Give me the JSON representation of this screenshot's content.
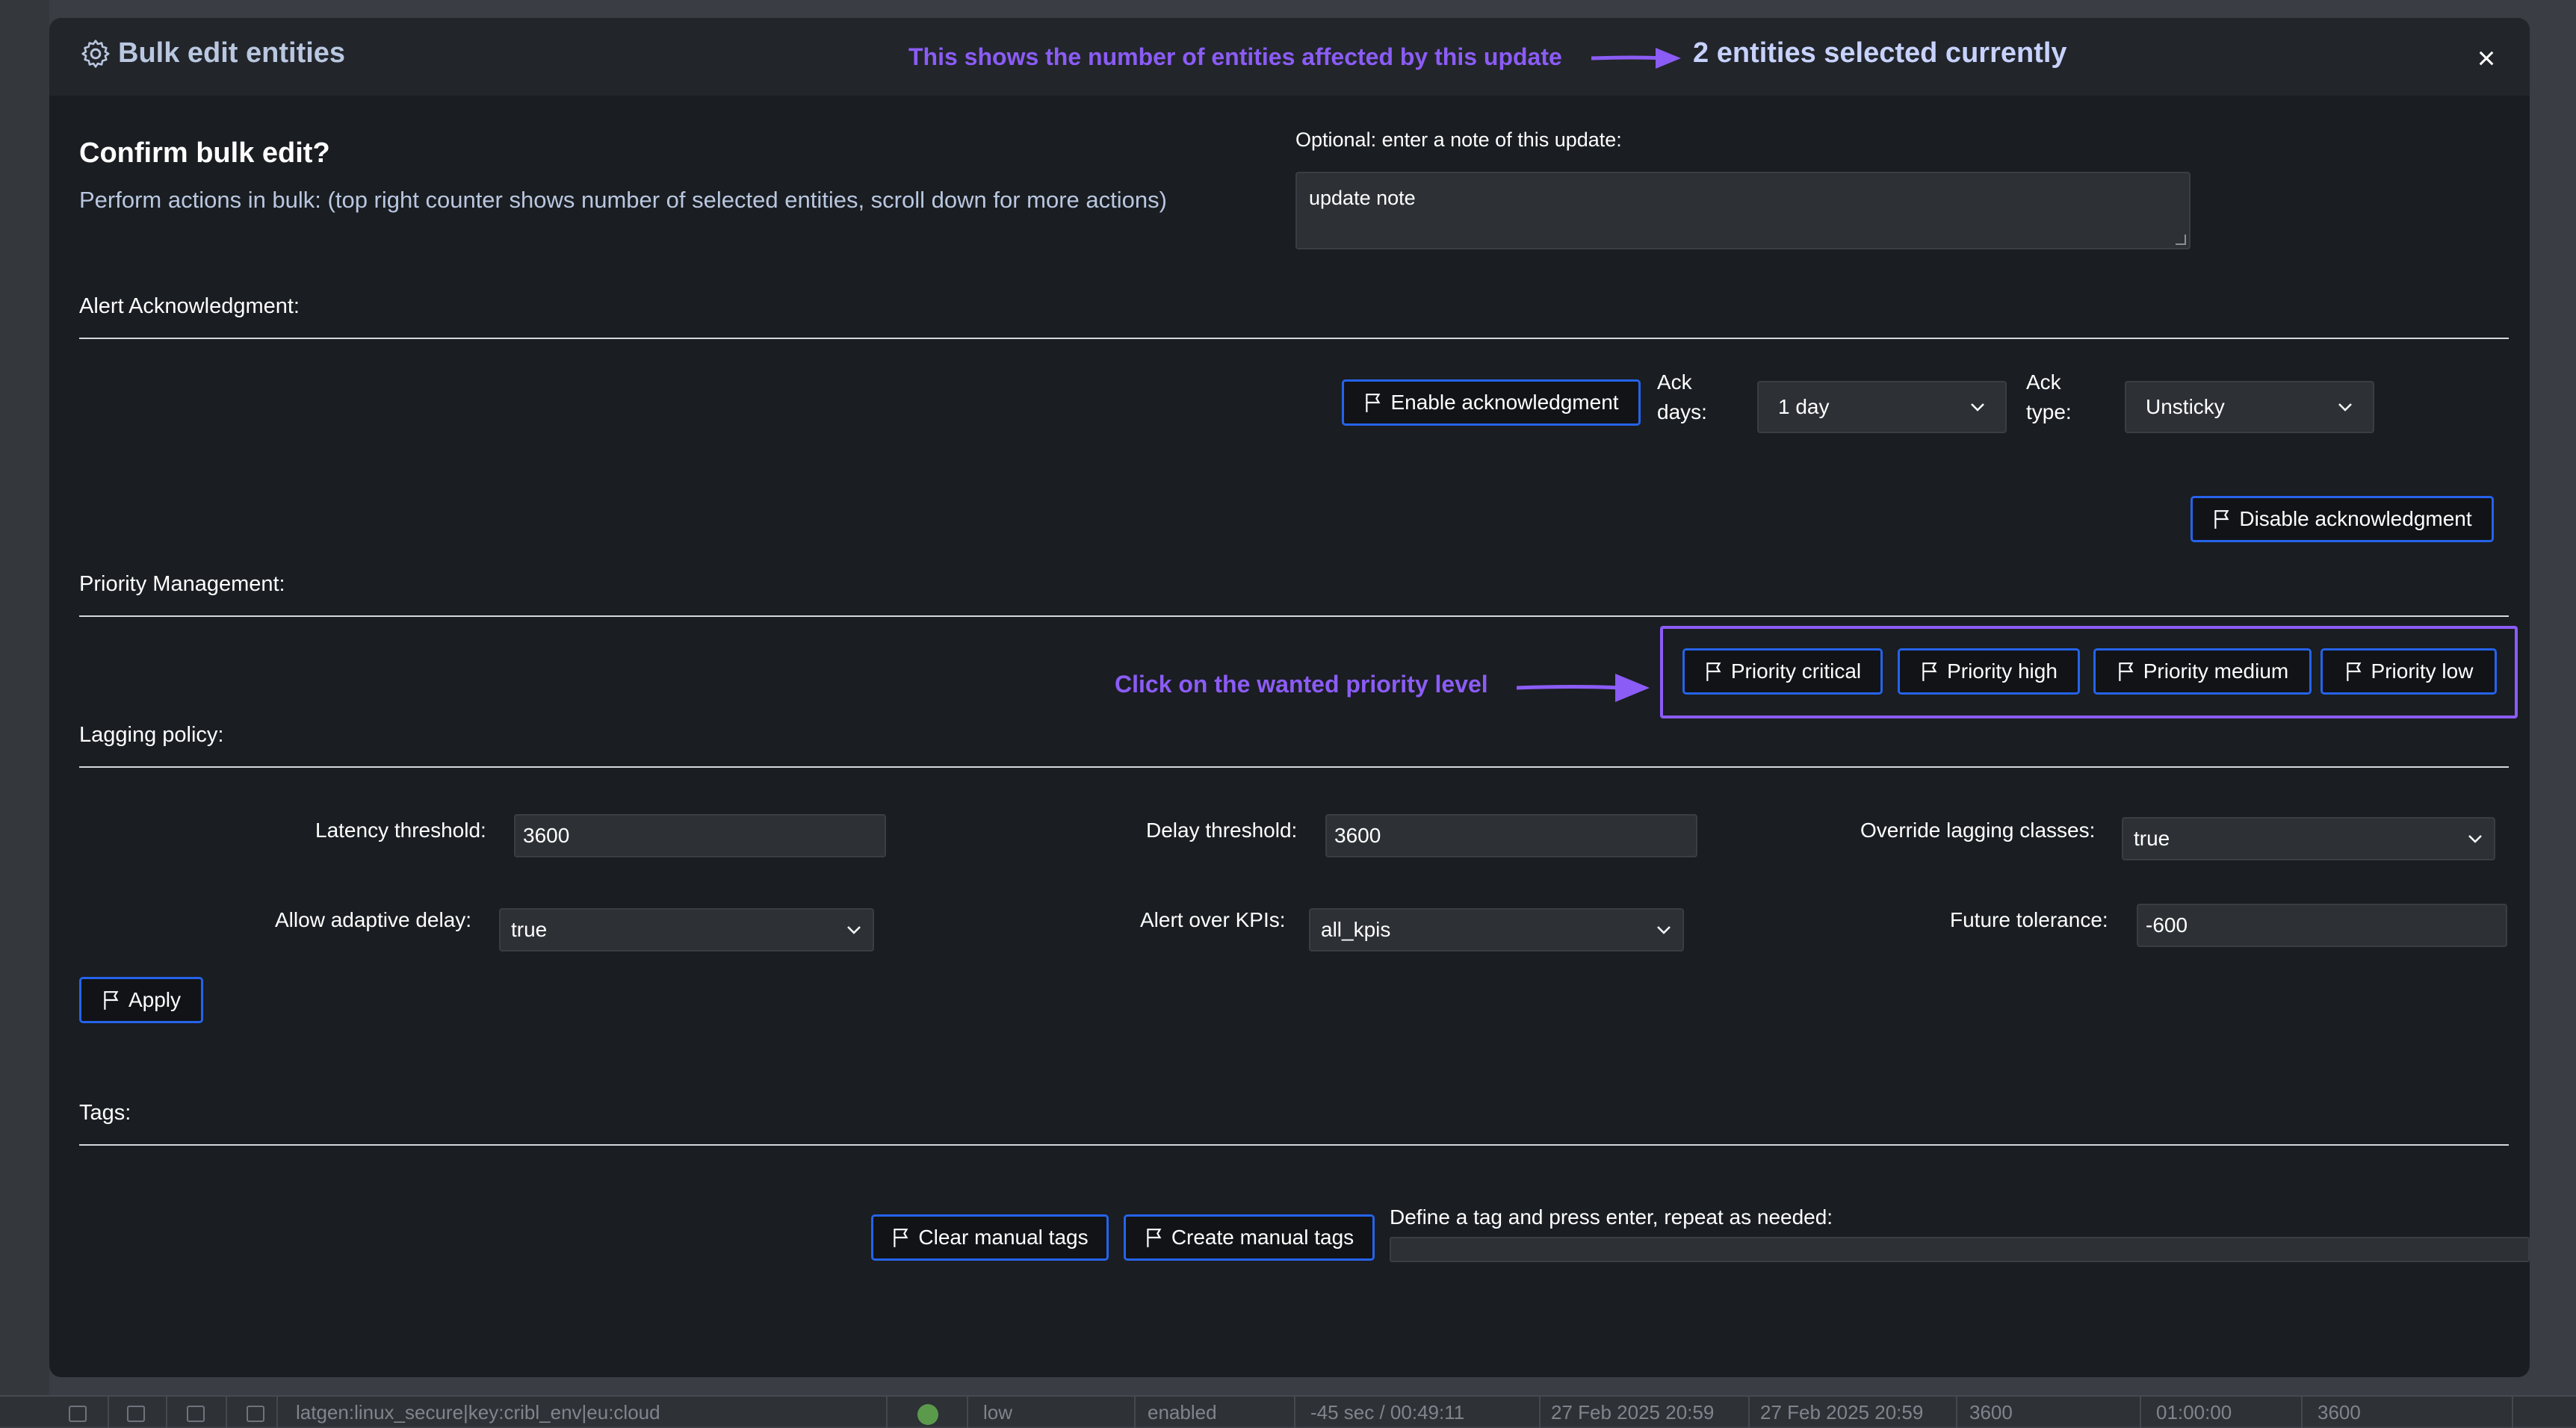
{
  "background": {
    "row_text": "latgen:linux_secure|key:cribl_env|eu:cloud",
    "row_priority": "low",
    "row_state": "enabled",
    "row_lag": "-45 sec / 00:49:11",
    "row_date1": "27 Feb 2025 20:59",
    "row_date2": "27 Feb 2025 20:59",
    "row_val1": "3600",
    "row_val2": "01:00:00",
    "row_val3": "3600"
  },
  "header": {
    "title": "Bulk edit entities",
    "annotation": "This shows the number of entities affected by this update",
    "count": "2 entities selected currently",
    "close": "×"
  },
  "intro": {
    "heading": "Confirm bulk edit?",
    "description": "Perform actions in bulk: (top right counter shows number of selected entities, scroll down for more actions)",
    "note_label": "Optional: enter a note of this update:",
    "note_value": "update note"
  },
  "acknowledgment": {
    "section": "Alert Acknowledgment:",
    "enable_label": "Enable acknowledgment",
    "ack_days_label_1": "Ack",
    "ack_days_label_2": "days:",
    "ack_days_value": "1 day",
    "ack_type_label_1": "Ack",
    "ack_type_label_2": "type:",
    "ack_type_value": "Unsticky",
    "disable_label": "Disable acknowledgment"
  },
  "priority": {
    "section": "Priority Management:",
    "annotation": "Click on the wanted priority level",
    "critical": "Priority critical",
    "high": "Priority high",
    "medium": "Priority medium",
    "low": "Priority low"
  },
  "lagging": {
    "section": "Lagging policy:",
    "latency_label": "Latency threshold:",
    "latency_value": "3600",
    "delay_label": "Delay threshold:",
    "delay_value": "3600",
    "override_label": "Override lagging classes:",
    "override_value": "true",
    "adaptive_label": "Allow adaptive delay:",
    "adaptive_value": "true",
    "kpis_label": "Alert over KPIs:",
    "kpis_value": "all_kpis",
    "tolerance_label": "Future tolerance:",
    "tolerance_value": "-600",
    "apply_label": "Apply"
  },
  "tags": {
    "section": "Tags:",
    "clear_label": "Clear manual tags",
    "create_label": "Create manual tags",
    "define_label": "Define a tag and press enter, repeat as needed:"
  },
  "colors": {
    "accent": "#8b5cf6",
    "button_border": "#2563eb",
    "modal_bg": "#1a1d21"
  }
}
